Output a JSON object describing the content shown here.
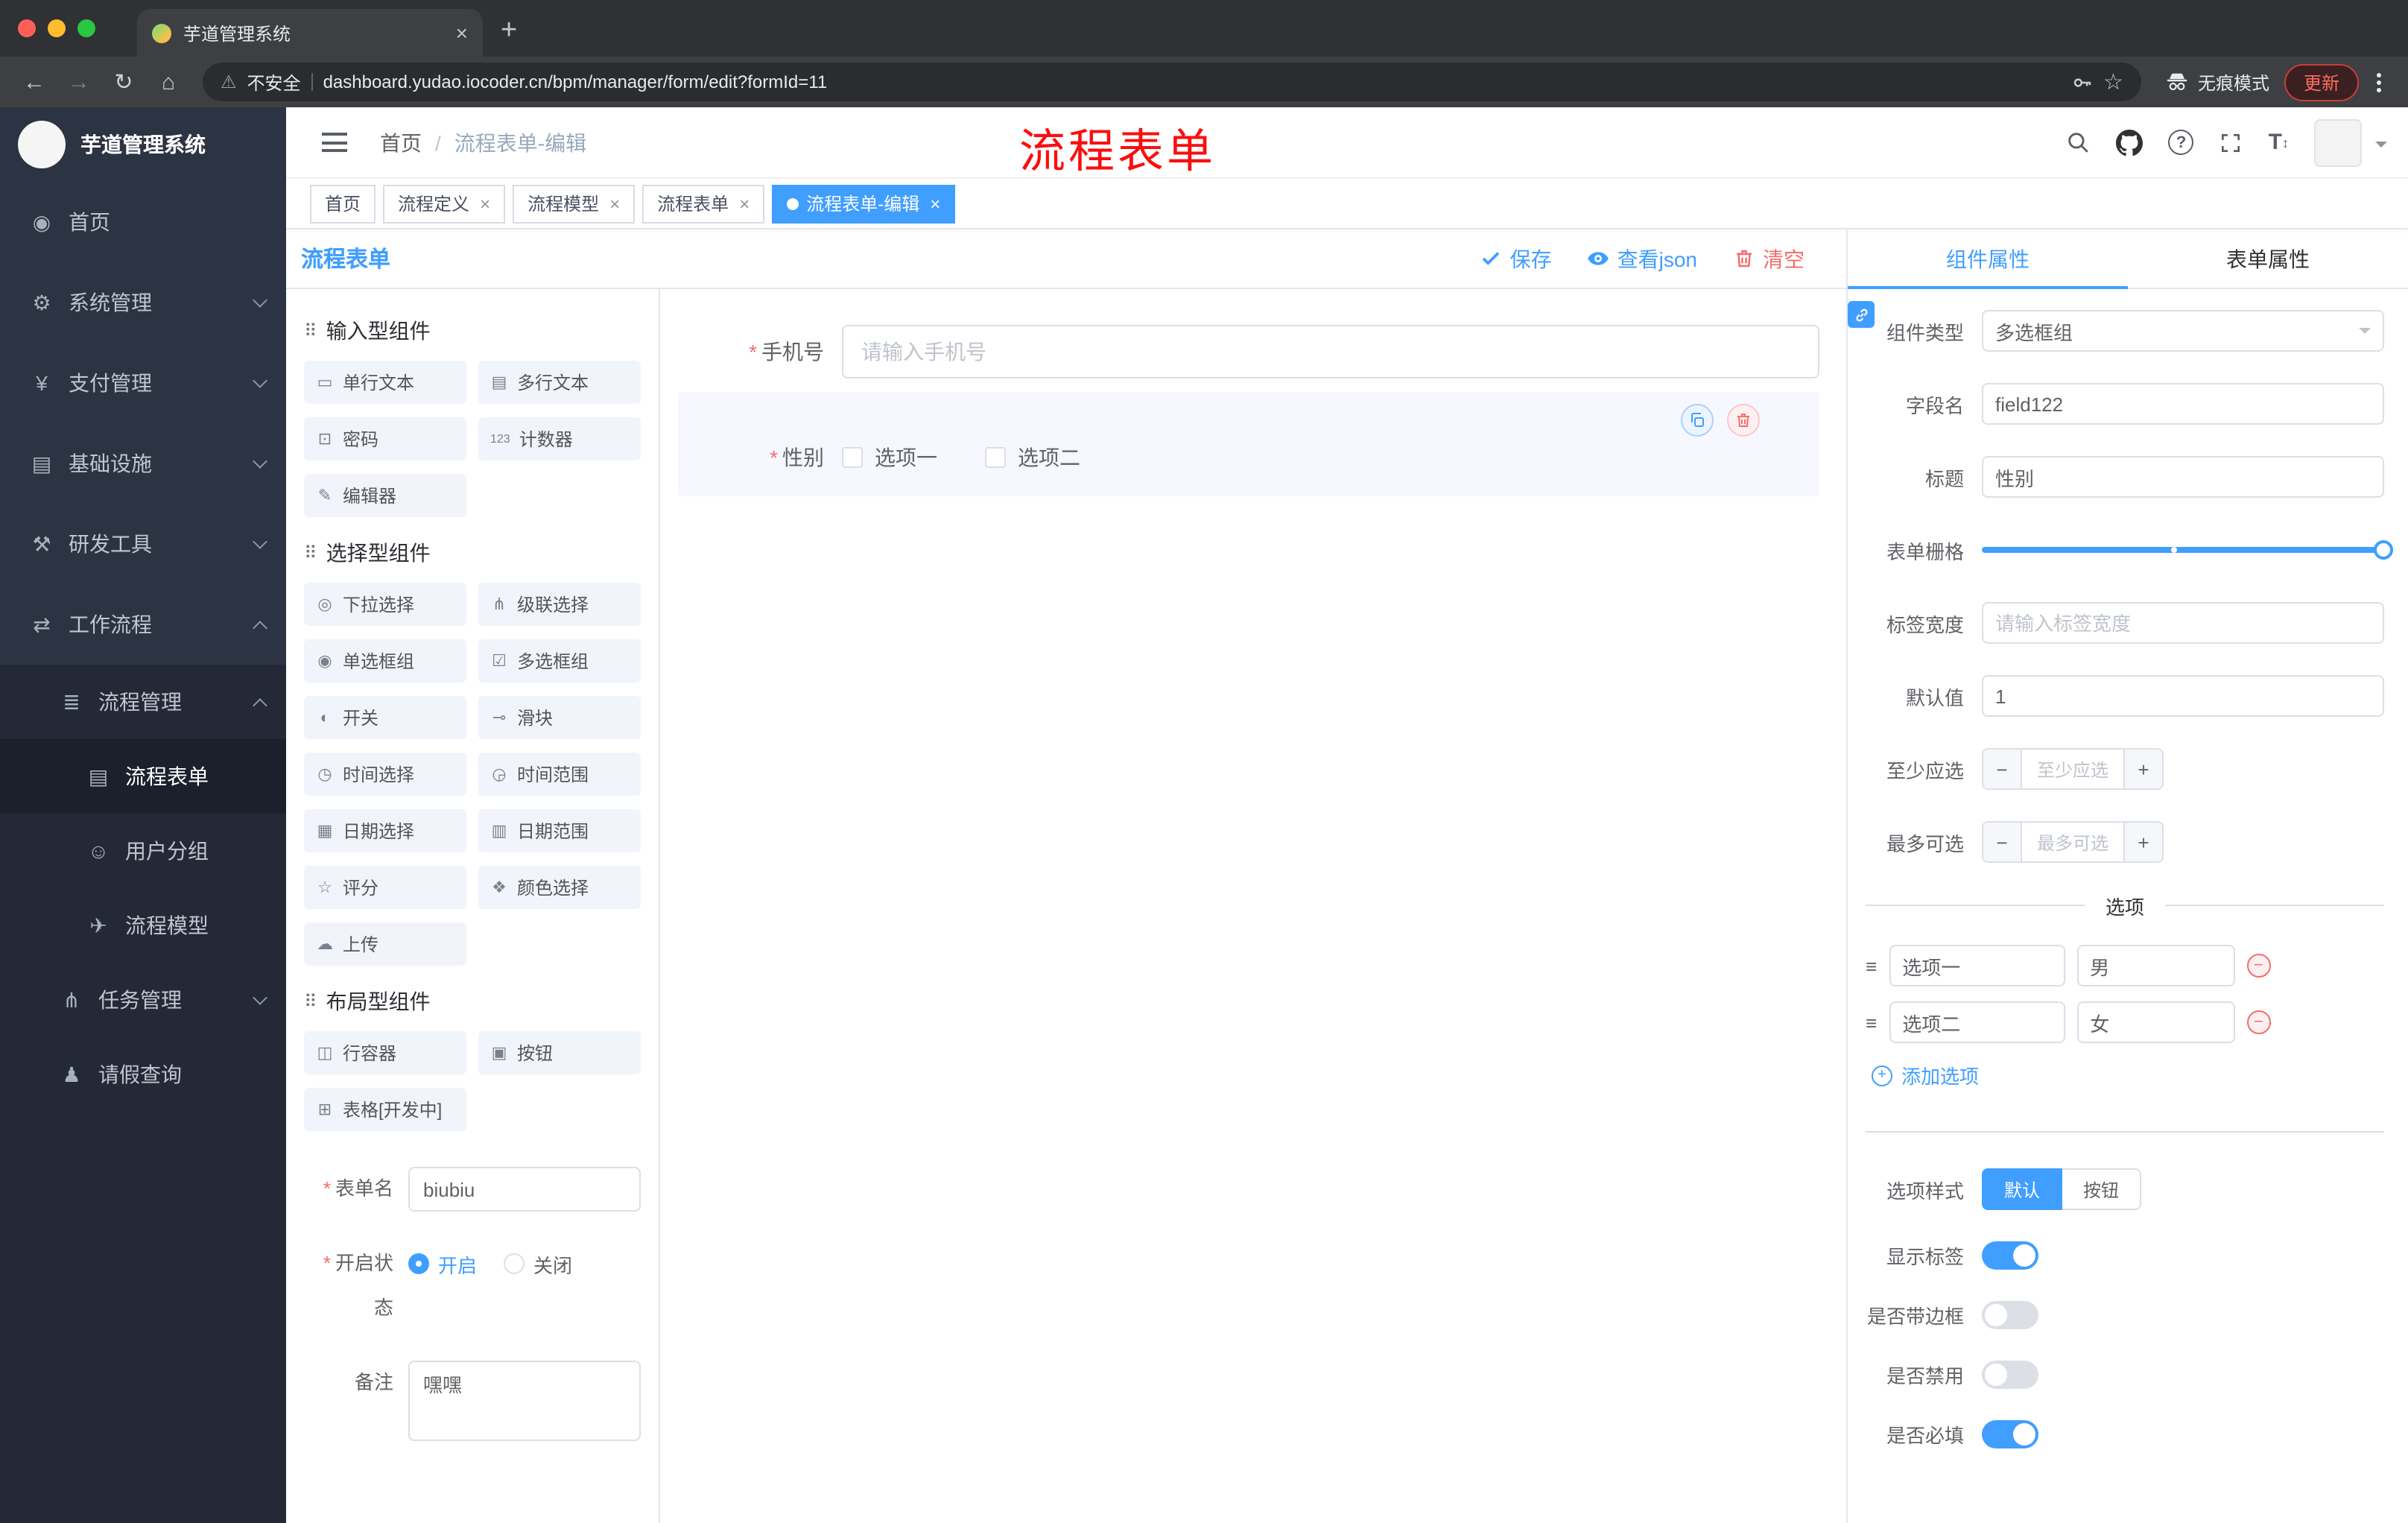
{
  "browser": {
    "tab_title": "芋道管理系统",
    "security_label": "不安全",
    "url": "dashboard.yudao.iocoder.cn/bpm/manager/form/edit?formId=11",
    "incognito_label": "无痕模式",
    "update_label": "更新"
  },
  "annotation": {
    "text": "流程表单"
  },
  "sidebar": {
    "title": "芋道管理系统",
    "items": [
      {
        "label": "首页",
        "glyph": "◉"
      },
      {
        "label": "系统管理",
        "glyph": "⚙"
      },
      {
        "label": "支付管理",
        "glyph": "¥"
      },
      {
        "label": "基础设施",
        "glyph": "▤"
      },
      {
        "label": "研发工具",
        "glyph": "⚒"
      },
      {
        "label": "工作流程",
        "glyph": "⇄"
      }
    ],
    "nested": [
      {
        "label": "流程管理",
        "glyph": "≣"
      },
      {
        "label": "流程表单",
        "glyph": "▤"
      },
      {
        "label": "用户分组",
        "glyph": "☺"
      },
      {
        "label": "流程模型",
        "glyph": "✈"
      },
      {
        "label": "任务管理",
        "glyph": "⋔"
      },
      {
        "label": "请假查询",
        "glyph": "♟"
      }
    ]
  },
  "header": {
    "breadcrumb": [
      "首页",
      "流程表单-编辑"
    ]
  },
  "tags": [
    {
      "label": "首页"
    },
    {
      "label": "流程定义"
    },
    {
      "label": "流程模型"
    },
    {
      "label": "流程表单"
    },
    {
      "label": "流程表单-编辑"
    }
  ],
  "designer": {
    "title": "流程表单",
    "actions": {
      "save": "保存",
      "view_json": "查看json",
      "clear": "清空"
    }
  },
  "palette": {
    "sections": [
      {
        "title": "输入型组件",
        "items": [
          {
            "label": "单行文本",
            "glyph": "▭"
          },
          {
            "label": "多行文本",
            "glyph": "▤"
          },
          {
            "label": "密码",
            "glyph": "⊡"
          },
          {
            "label": "计数器",
            "glyph": "123"
          },
          {
            "label": "编辑器",
            "glyph": "✎"
          }
        ]
      },
      {
        "title": "选择型组件",
        "items": [
          {
            "label": "下拉选择",
            "glyph": "◎"
          },
          {
            "label": "级联选择",
            "glyph": "⋔"
          },
          {
            "label": "单选框组",
            "glyph": "◉"
          },
          {
            "label": "多选框组",
            "glyph": "☑"
          },
          {
            "label": "开关",
            "glyph": "◐"
          },
          {
            "label": "滑块",
            "glyph": "⊸"
          },
          {
            "label": "时间选择",
            "glyph": "◷"
          },
          {
            "label": "时间范围",
            "glyph": "◶"
          },
          {
            "label": "日期选择",
            "glyph": "▦"
          },
          {
            "label": "日期范围",
            "glyph": "▥"
          },
          {
            "label": "评分",
            "glyph": "☆"
          },
          {
            "label": "颜色选择",
            "glyph": "❖"
          },
          {
            "label": "上传",
            "glyph": "☁"
          }
        ]
      },
      {
        "title": "布局型组件",
        "items": [
          {
            "label": "行容器",
            "glyph": "◫"
          },
          {
            "label": "按钮",
            "glyph": "▣"
          },
          {
            "label": "表格[开发中]",
            "glyph": "⊞"
          }
        ]
      }
    ],
    "form": {
      "name_label": "表单名",
      "name_value": "biubiu",
      "status_label": "开启状态",
      "status_on": "开启",
      "status_off": "关闭",
      "remark_label": "备注",
      "remark_value": "嘿嘿"
    }
  },
  "canvas": {
    "phone": {
      "label": "手机号",
      "placeholder": "请输入手机号"
    },
    "gender": {
      "label": "性别",
      "options": [
        "选项一",
        "选项二"
      ]
    }
  },
  "props": {
    "tabs": [
      "组件属性",
      "表单属性"
    ],
    "component_type_label": "组件类型",
    "component_type_value": "多选框组",
    "field_name_label": "字段名",
    "field_name_value": "field122",
    "title_label": "标题",
    "title_value": "性别",
    "grid_label": "表单栅格",
    "label_width_label": "标签宽度",
    "label_width_placeholder": "请输入标签宽度",
    "default_label": "默认值",
    "default_value": "1",
    "min_label": "至少应选",
    "min_placeholder": "至少应选",
    "max_label": "最多可选",
    "max_placeholder": "最多可选",
    "options_title": "选项",
    "options": [
      {
        "label": "选项一",
        "value": "男"
      },
      {
        "label": "选项二",
        "value": "女"
      }
    ],
    "add_option": "添加选项",
    "style_label": "选项样式",
    "style_options": [
      "默认",
      "按钮"
    ],
    "toggle_show_label": "显示标签",
    "toggle_border": "是否带边框",
    "toggle_disabled": "是否禁用",
    "toggle_required": "是否必填"
  },
  "colors": {
    "primary": "#409eff",
    "danger": "#f56c6c",
    "annotation": "#fb0e0e"
  }
}
